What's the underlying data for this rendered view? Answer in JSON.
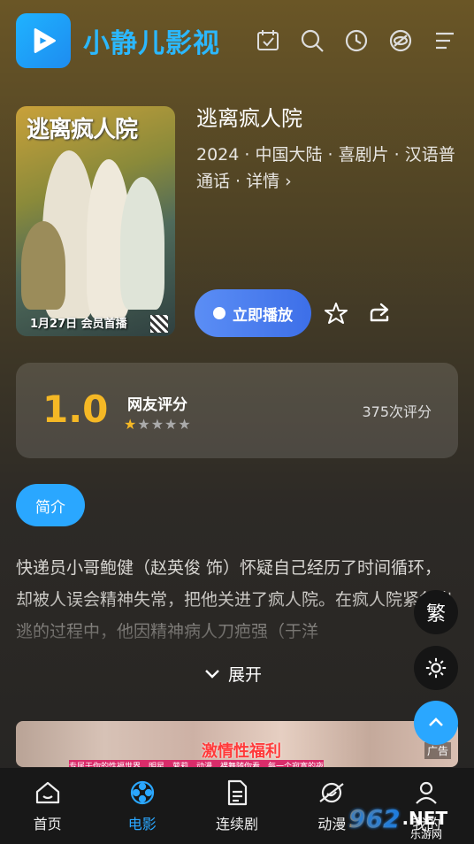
{
  "app": {
    "title": "小静儿影视"
  },
  "header": {
    "icons": [
      "calendar-check-icon",
      "search-icon",
      "history-icon",
      "eye-slash-icon",
      "menu-icon"
    ]
  },
  "poster": {
    "title": "逃离疯人院",
    "date_text": "1月27日 会员首播"
  },
  "movie": {
    "title": "逃离疯人院",
    "meta": "2024 · 中国大陆 · 喜剧片 · 汉语普通话 · 详情 ›",
    "play_label": "立即播放"
  },
  "rating": {
    "score": "1.0",
    "label": "网友评分",
    "stars_filled": 1,
    "stars_total": 5,
    "count": "375次评分"
  },
  "intro": {
    "tab_label": "简介",
    "text": "快递员小哥鲍健（赵英俊 饰）怀疑自己经历了时间循环，却被人误会精神失常，把他关进了疯人院。在疯人院紧急出逃的过程中，他因精神病人刀疤强（于洋",
    "expand_label": "展开"
  },
  "floating": {
    "traditional_label": "繁"
  },
  "banner": {
    "title": "激情性福利",
    "tag": "广告",
    "subtitle": "专属于你的性福世界，明星、萝莉、动漫、裸舞随你看，每一个寂寞的夜"
  },
  "tabs": [
    {
      "label": "首页",
      "icon": "home-icon"
    },
    {
      "label": "电影",
      "icon": "film-reel-icon",
      "active": true
    },
    {
      "label": "连续剧",
      "icon": "document-icon"
    },
    {
      "label": "动漫",
      "icon": "planet-icon"
    },
    {
      "label": "我的",
      "icon": "user-icon"
    }
  ],
  "watermark": {
    "number": "962",
    "suffix": ".NET",
    "sub": "乐游网"
  },
  "colors": {
    "accent": "#2aa7ff",
    "score": "#f5b825",
    "play_button": "#4a7df0"
  }
}
